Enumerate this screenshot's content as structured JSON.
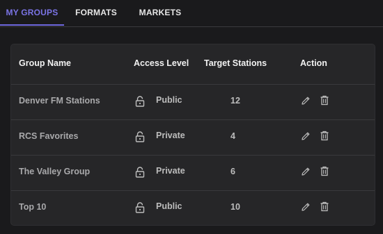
{
  "tabs": [
    {
      "label": "MY GROUPS",
      "active": true
    },
    {
      "label": "FORMATS",
      "active": false
    },
    {
      "label": "MARKETS",
      "active": false
    }
  ],
  "table": {
    "headers": {
      "group_name": "Group Name",
      "access_level": "Access Level",
      "target_stations": "Target Stations",
      "action": "Action"
    },
    "rows": [
      {
        "name": "Denver FM Stations",
        "access": "Public",
        "stations": "12"
      },
      {
        "name": "RCS Favorites",
        "access": "Private",
        "stations": "4"
      },
      {
        "name": "The Valley Group",
        "access": "Private",
        "stations": "6"
      },
      {
        "name": "Top 10",
        "access": "Public",
        "stations": "10"
      }
    ]
  },
  "icons": {
    "access": "lock-icon",
    "edit": "pencil-icon",
    "delete": "trash-icon"
  },
  "colors": {
    "accent": "#6f68df",
    "background": "#1a1a1c",
    "card": "#262628"
  }
}
